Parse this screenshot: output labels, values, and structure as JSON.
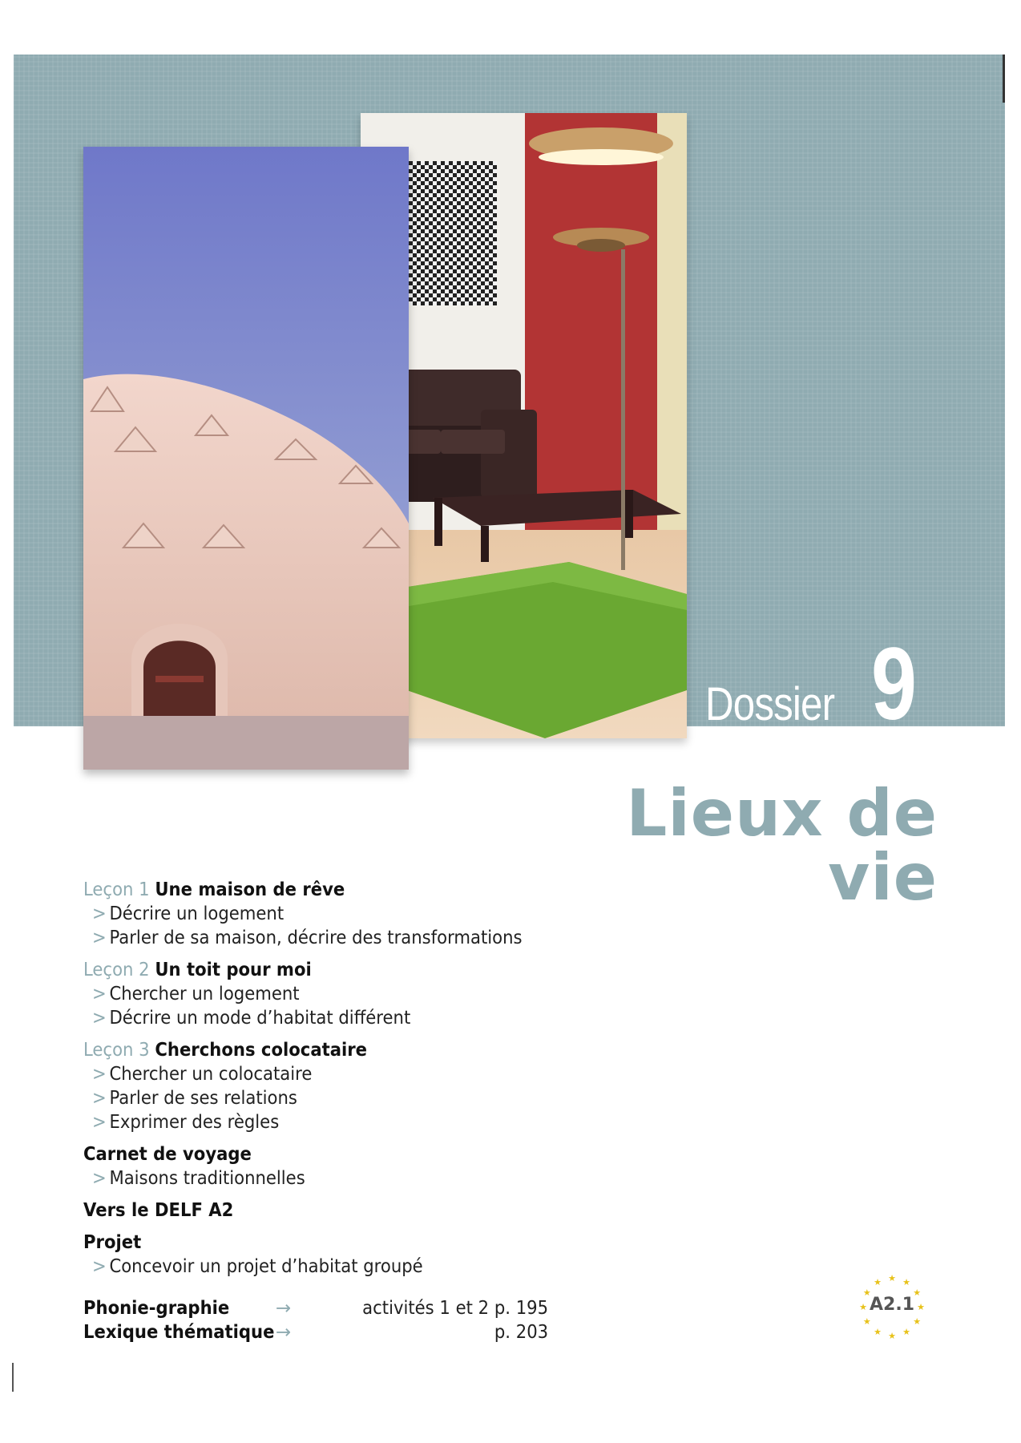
{
  "banner": {
    "dossier_word": "Dossier",
    "dossier_number": "9",
    "color": "#8fabb1"
  },
  "title": "Lieux de vie",
  "lessons": [
    {
      "prefix": "Leçon 1",
      "name": "Une maison de rêve",
      "items": [
        "Décrire un logement",
        "Parler de sa maison, décrire des transformations"
      ]
    },
    {
      "prefix": "Leçon 2",
      "name": "Un toit pour moi",
      "items": [
        "Chercher un logement",
        "Décrire un mode d’habitat différent"
      ]
    },
    {
      "prefix": "Leçon 3",
      "name": "Cherchons colocataire",
      "items": [
        "Chercher un colocataire",
        "Parler de ses relations",
        "Exprimer des règles"
      ]
    }
  ],
  "carnet": {
    "heading": "Carnet de voyage",
    "items": [
      "Maisons traditionnelles"
    ]
  },
  "delf": {
    "heading": "Vers le DELF A2"
  },
  "projet": {
    "heading": "Projet",
    "items": [
      "Concevoir un projet d’habitat groupé"
    ]
  },
  "references": [
    {
      "label": "Phonie-graphie",
      "arrow": "→",
      "text": "activités 1 et 2 p. 195"
    },
    {
      "label": "Lexique thématique",
      "arrow": "→",
      "text": "p. 203"
    }
  ],
  "level_badge": {
    "label": "A2.1",
    "star_color": "#e8c21a"
  },
  "icons": {
    "bullet": "chevron-right-icon",
    "arrow": "arrow-right-icon"
  }
}
